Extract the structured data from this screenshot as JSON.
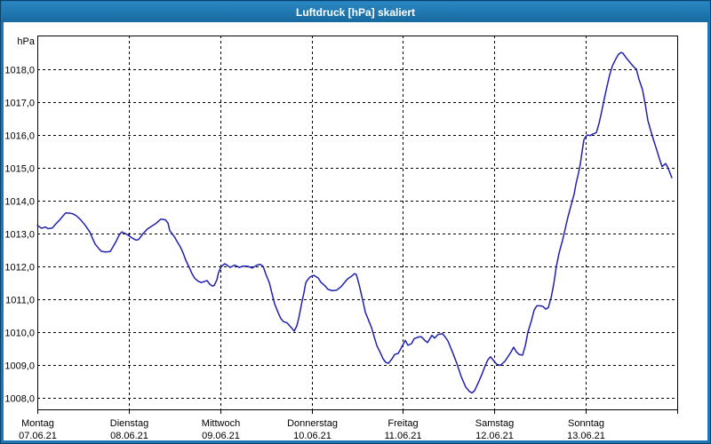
{
  "window": {
    "title": "Luftdruck [hPa] skaliert"
  },
  "colors": {
    "frame": "#1e76b4",
    "frame_outer": "#0a4268",
    "titlebar_top": "#2a87c2",
    "titlebar_bottom": "#176a9f",
    "title_text": "#ffffff",
    "background": "#ffffff",
    "plot_border": "#000000",
    "grid": "#000000",
    "line": "#2121ad",
    "text": "#000000"
  },
  "chart_data": {
    "type": "line",
    "title": "Luftdruck [hPa] skaliert",
    "xlabel": "",
    "ylabel": "hPa",
    "unit": "hPa",
    "ylim": [
      1007.6,
      1019.0
    ],
    "grid": "dashed black, 1 hPa horizontal steps, 1 day vertical steps",
    "legend": "none",
    "y_ticks": [
      {
        "value": 1018,
        "label": "1018,0"
      },
      {
        "value": 1017,
        "label": "1017,0"
      },
      {
        "value": 1016,
        "label": "1016,0"
      },
      {
        "value": 1015,
        "label": "1015,0"
      },
      {
        "value": 1014,
        "label": "1014,0"
      },
      {
        "value": 1013,
        "label": "1013,0"
      },
      {
        "value": 1012,
        "label": "1012,0"
      },
      {
        "value": 1011,
        "label": "1011,0"
      },
      {
        "value": 1010,
        "label": "1010,0"
      },
      {
        "value": 1009,
        "label": "1009,0"
      },
      {
        "value": 1008,
        "label": "1008,0"
      }
    ],
    "x_ticks": [
      {
        "day": 0,
        "name": "Montag",
        "date": "07.06.21"
      },
      {
        "day": 1,
        "name": "Dienstag",
        "date": "08.06.21"
      },
      {
        "day": 2,
        "name": "Mittwoch",
        "date": "09.06.21"
      },
      {
        "day": 3,
        "name": "Donnerstag",
        "date": "10.06.21"
      },
      {
        "day": 4,
        "name": "Freitag",
        "date": "11.06.21"
      },
      {
        "day": 5,
        "name": "Samstag",
        "date": "12.06.21"
      },
      {
        "day": 6,
        "name": "Sonntag",
        "date": "13.06.21"
      }
    ],
    "x_range_days": 7,
    "series": [
      {
        "name": "Luftdruck",
        "color": "#2121ad",
        "x_unit": "days since Montag 07.06.21 00:00",
        "points": [
          [
            0.0,
            1013.25
          ],
          [
            0.049,
            1013.16
          ],
          [
            0.088,
            1013.2
          ],
          [
            0.117,
            1013.15
          ],
          [
            0.165,
            1013.17
          ],
          [
            0.194,
            1013.27
          ],
          [
            0.243,
            1013.41
          ],
          [
            0.282,
            1013.54
          ],
          [
            0.311,
            1013.63
          ],
          [
            0.36,
            1013.62
          ],
          [
            0.389,
            1013.6
          ],
          [
            0.428,
            1013.54
          ],
          [
            0.476,
            1013.41
          ],
          [
            0.525,
            1013.25
          ],
          [
            0.574,
            1013.05
          ],
          [
            0.603,
            1012.86
          ],
          [
            0.632,
            1012.68
          ],
          [
            0.671,
            1012.55
          ],
          [
            0.7,
            1012.46
          ],
          [
            0.749,
            1012.44
          ],
          [
            0.797,
            1012.45
          ],
          [
            0.826,
            1012.59
          ],
          [
            0.865,
            1012.78
          ],
          [
            0.894,
            1012.95
          ],
          [
            0.924,
            1013.05
          ],
          [
            0.963,
            1013.0
          ],
          [
            0.992,
            1012.95
          ],
          [
            1.04,
            1012.86
          ],
          [
            1.079,
            1012.8
          ],
          [
            1.108,
            1012.82
          ],
          [
            1.157,
            1013.0
          ],
          [
            1.206,
            1013.14
          ],
          [
            1.254,
            1013.23
          ],
          [
            1.303,
            1013.32
          ],
          [
            1.351,
            1013.44
          ],
          [
            1.4,
            1013.42
          ],
          [
            1.429,
            1013.32
          ],
          [
            1.449,
            1013.09
          ],
          [
            1.497,
            1012.91
          ],
          [
            1.526,
            1012.77
          ],
          [
            1.565,
            1012.59
          ],
          [
            1.594,
            1012.41
          ],
          [
            1.624,
            1012.19
          ],
          [
            1.663,
            1011.96
          ],
          [
            1.692,
            1011.78
          ],
          [
            1.721,
            1011.64
          ],
          [
            1.76,
            1011.55
          ],
          [
            1.789,
            1011.51
          ],
          [
            1.818,
            1011.53
          ],
          [
            1.857,
            1011.57
          ],
          [
            1.886,
            1011.46
          ],
          [
            1.915,
            1011.4
          ],
          [
            1.935,
            1011.42
          ],
          [
            1.964,
            1011.59
          ],
          [
            1.983,
            1011.82
          ],
          [
            2.013,
            1012.0
          ],
          [
            2.051,
            1012.08
          ],
          [
            2.11,
            1011.97
          ],
          [
            2.158,
            1012.04
          ],
          [
            2.207,
            1011.97
          ],
          [
            2.256,
            1012.01
          ],
          [
            2.304,
            1012.0
          ],
          [
            2.353,
            1011.95
          ],
          [
            2.402,
            1012.04
          ],
          [
            2.44,
            1012.06
          ],
          [
            2.47,
            1012.0
          ],
          [
            2.499,
            1011.77
          ],
          [
            2.538,
            1011.5
          ],
          [
            2.567,
            1011.18
          ],
          [
            2.596,
            1010.86
          ],
          [
            2.635,
            1010.59
          ],
          [
            2.664,
            1010.41
          ],
          [
            2.693,
            1010.32
          ],
          [
            2.732,
            1010.28
          ],
          [
            2.761,
            1010.19
          ],
          [
            2.79,
            1010.1
          ],
          [
            2.81,
            1010.03
          ],
          [
            2.839,
            1010.19
          ],
          [
            2.858,
            1010.41
          ],
          [
            2.878,
            1010.68
          ],
          [
            2.897,
            1010.95
          ],
          [
            2.917,
            1011.2
          ],
          [
            2.936,
            1011.5
          ],
          [
            2.956,
            1011.59
          ],
          [
            2.985,
            1011.68
          ],
          [
            3.024,
            1011.73
          ],
          [
            3.072,
            1011.65
          ],
          [
            3.101,
            1011.52
          ],
          [
            3.15,
            1011.4
          ],
          [
            3.179,
            1011.3
          ],
          [
            3.228,
            1011.26
          ],
          [
            3.276,
            1011.28
          ],
          [
            3.325,
            1011.39
          ],
          [
            3.393,
            1011.62
          ],
          [
            3.442,
            1011.71
          ],
          [
            3.471,
            1011.78
          ],
          [
            3.49,
            1011.75
          ],
          [
            3.52,
            1011.44
          ],
          [
            3.558,
            1010.99
          ],
          [
            3.588,
            1010.6
          ],
          [
            3.617,
            1010.41
          ],
          [
            3.656,
            1010.14
          ],
          [
            3.685,
            1009.86
          ],
          [
            3.714,
            1009.59
          ],
          [
            3.753,
            1009.37
          ],
          [
            3.782,
            1009.19
          ],
          [
            3.811,
            1009.08
          ],
          [
            3.841,
            1009.05
          ],
          [
            3.88,
            1009.19
          ],
          [
            3.909,
            1009.32
          ],
          [
            3.947,
            1009.35
          ],
          [
            3.977,
            1009.5
          ],
          [
            4.025,
            1009.75
          ],
          [
            4.054,
            1009.6
          ],
          [
            4.093,
            1009.65
          ],
          [
            4.122,
            1009.8
          ],
          [
            4.171,
            1009.85
          ],
          [
            4.2,
            1009.86
          ],
          [
            4.239,
            1009.75
          ],
          [
            4.268,
            1009.68
          ],
          [
            4.317,
            1009.9
          ],
          [
            4.346,
            1009.82
          ],
          [
            4.385,
            1009.93
          ],
          [
            4.433,
            1009.95
          ],
          [
            4.462,
            1009.85
          ],
          [
            4.492,
            1009.73
          ],
          [
            4.54,
            1009.4
          ],
          [
            4.589,
            1009.05
          ],
          [
            4.637,
            1008.65
          ],
          [
            4.686,
            1008.33
          ],
          [
            4.725,
            1008.2
          ],
          [
            4.754,
            1008.15
          ],
          [
            4.783,
            1008.22
          ],
          [
            4.822,
            1008.45
          ],
          [
            4.861,
            1008.7
          ],
          [
            4.9,
            1008.98
          ],
          [
            4.929,
            1009.16
          ],
          [
            4.958,
            1009.25
          ],
          [
            4.997,
            1009.11
          ],
          [
            5.026,
            1009.02
          ],
          [
            5.065,
            1008.99
          ],
          [
            5.114,
            1009.11
          ],
          [
            5.172,
            1009.35
          ],
          [
            5.211,
            1009.54
          ],
          [
            5.24,
            1009.4
          ],
          [
            5.27,
            1009.32
          ],
          [
            5.308,
            1009.3
          ],
          [
            5.338,
            1009.59
          ],
          [
            5.367,
            1010.0
          ],
          [
            5.406,
            1010.35
          ],
          [
            5.435,
            1010.67
          ],
          [
            5.464,
            1010.8
          ],
          [
            5.503,
            1010.8
          ],
          [
            5.532,
            1010.78
          ],
          [
            5.561,
            1010.7
          ],
          [
            5.59,
            1010.75
          ],
          [
            5.62,
            1011.05
          ],
          [
            5.649,
            1011.45
          ],
          [
            5.678,
            1012.0
          ],
          [
            5.707,
            1012.4
          ],
          [
            5.746,
            1012.8
          ],
          [
            5.775,
            1013.15
          ],
          [
            5.804,
            1013.5
          ],
          [
            5.843,
            1013.9
          ],
          [
            5.872,
            1014.2
          ],
          [
            5.892,
            1014.5
          ],
          [
            5.921,
            1014.85
          ],
          [
            5.94,
            1015.13
          ],
          [
            5.96,
            1015.5
          ],
          [
            5.979,
            1015.85
          ],
          [
            5.999,
            1015.95
          ],
          [
            6.018,
            1016.0
          ],
          [
            6.047,
            1015.98
          ],
          [
            6.076,
            1016.03
          ],
          [
            6.115,
            1016.07
          ],
          [
            6.144,
            1016.35
          ],
          [
            6.173,
            1016.7
          ],
          [
            6.202,
            1017.1
          ],
          [
            6.231,
            1017.47
          ],
          [
            6.261,
            1017.83
          ],
          [
            6.29,
            1018.1
          ],
          [
            6.329,
            1018.32
          ],
          [
            6.358,
            1018.46
          ],
          [
            6.387,
            1018.51
          ],
          [
            6.406,
            1018.49
          ],
          [
            6.436,
            1018.37
          ],
          [
            6.474,
            1018.24
          ],
          [
            6.503,
            1018.14
          ],
          [
            6.533,
            1018.05
          ],
          [
            6.552,
            1018.01
          ],
          [
            6.581,
            1017.7
          ],
          [
            6.62,
            1017.38
          ],
          [
            6.649,
            1016.95
          ],
          [
            6.678,
            1016.45
          ],
          [
            6.708,
            1016.15
          ],
          [
            6.746,
            1015.8
          ],
          [
            6.775,
            1015.55
          ],
          [
            6.805,
            1015.28
          ],
          [
            6.834,
            1015.04
          ],
          [
            6.853,
            1015.08
          ],
          [
            6.873,
            1015.13
          ],
          [
            6.892,
            1015.04
          ],
          [
            6.912,
            1014.91
          ],
          [
            6.941,
            1014.7
          ]
        ]
      }
    ]
  }
}
